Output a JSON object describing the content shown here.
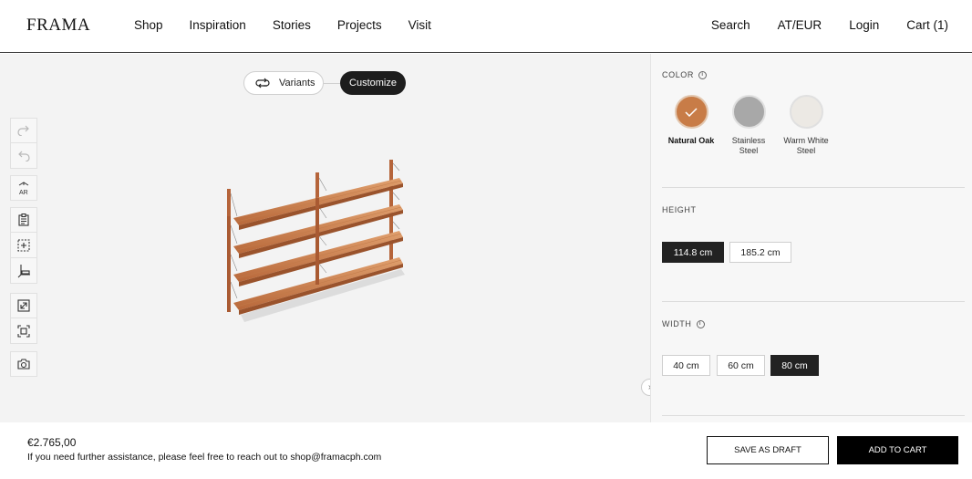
{
  "header": {
    "logo": "FRAMA",
    "nav_left": [
      "Shop",
      "Inspiration",
      "Stories",
      "Projects",
      "Visit"
    ],
    "nav_right": [
      "Search",
      "AT/EUR",
      "Login",
      "Cart (1)"
    ]
  },
  "viewer": {
    "modes": {
      "variants": "Variants",
      "customize": "Customize",
      "active": "Customize"
    },
    "tools": [
      "redo-icon",
      "undo-icon",
      "ar-icon",
      "clipboard-icon",
      "add-module-icon",
      "measure-icon",
      "expand-icon",
      "frame-icon",
      "camera-icon"
    ],
    "ar_label": "AR"
  },
  "panel": {
    "color": {
      "label": "COLOR",
      "options": [
        {
          "name": "Natural Oak",
          "color": "#c87c47",
          "selected": true
        },
        {
          "name": "Stainless Steel",
          "color": "#a8a8a8",
          "selected": false
        },
        {
          "name": "Warm White Steel",
          "color": "#ece9e4",
          "selected": false
        }
      ]
    },
    "height": {
      "label": "HEIGHT",
      "options": [
        "114.8 cm",
        "185.2 cm"
      ],
      "selected": "114.8 cm"
    },
    "width": {
      "label": "WIDTH",
      "options": [
        "40 cm",
        "60 cm",
        "80 cm"
      ],
      "selected": "80 cm"
    }
  },
  "footer": {
    "price": "€2.765,00",
    "assistance": "If you need further assistance, please feel free to reach out to shop@framacph.com",
    "save_label": "SAVE AS DRAFT",
    "cart_label": "ADD TO CART"
  },
  "colors": {
    "accent": "#1d1d1d",
    "oak": "#c87c47"
  }
}
